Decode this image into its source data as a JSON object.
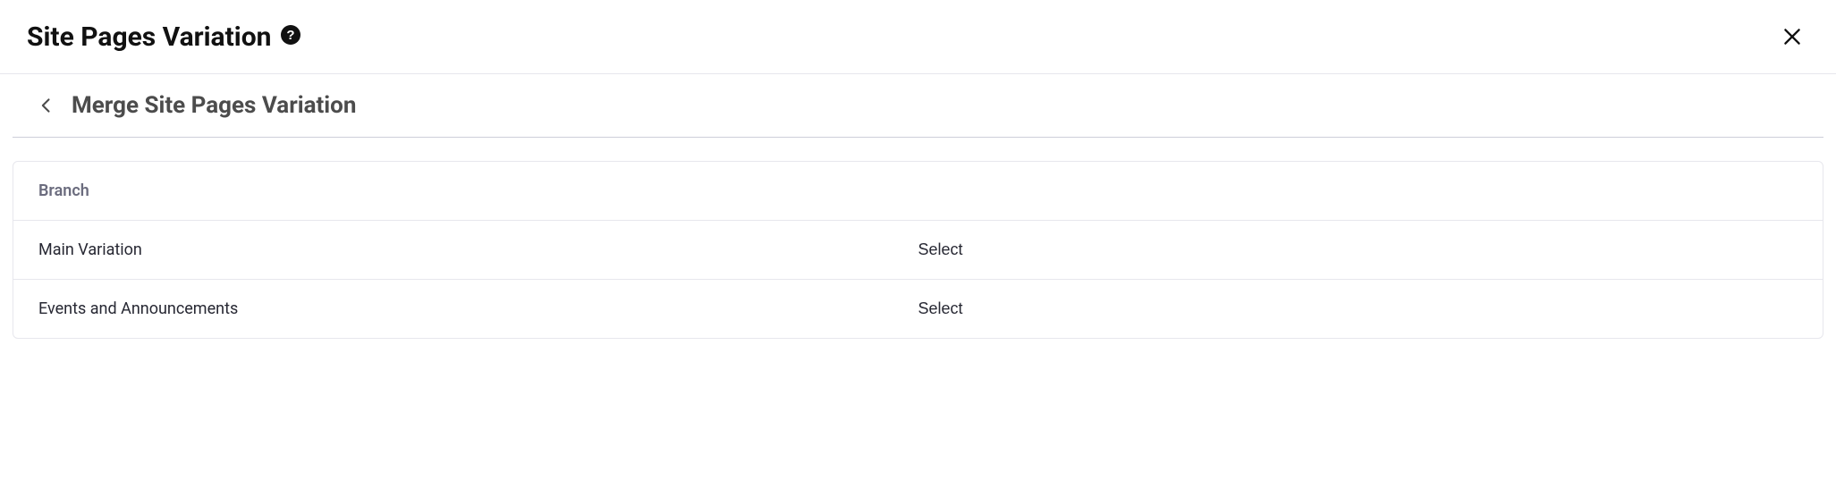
{
  "header": {
    "title": "Site Pages Variation"
  },
  "subheader": {
    "title": "Merge Site Pages Variation"
  },
  "panel": {
    "column_label": "Branch",
    "rows": [
      {
        "name": "Main Variation",
        "action": "Select"
      },
      {
        "name": "Events and Announcements",
        "action": "Select"
      }
    ]
  }
}
